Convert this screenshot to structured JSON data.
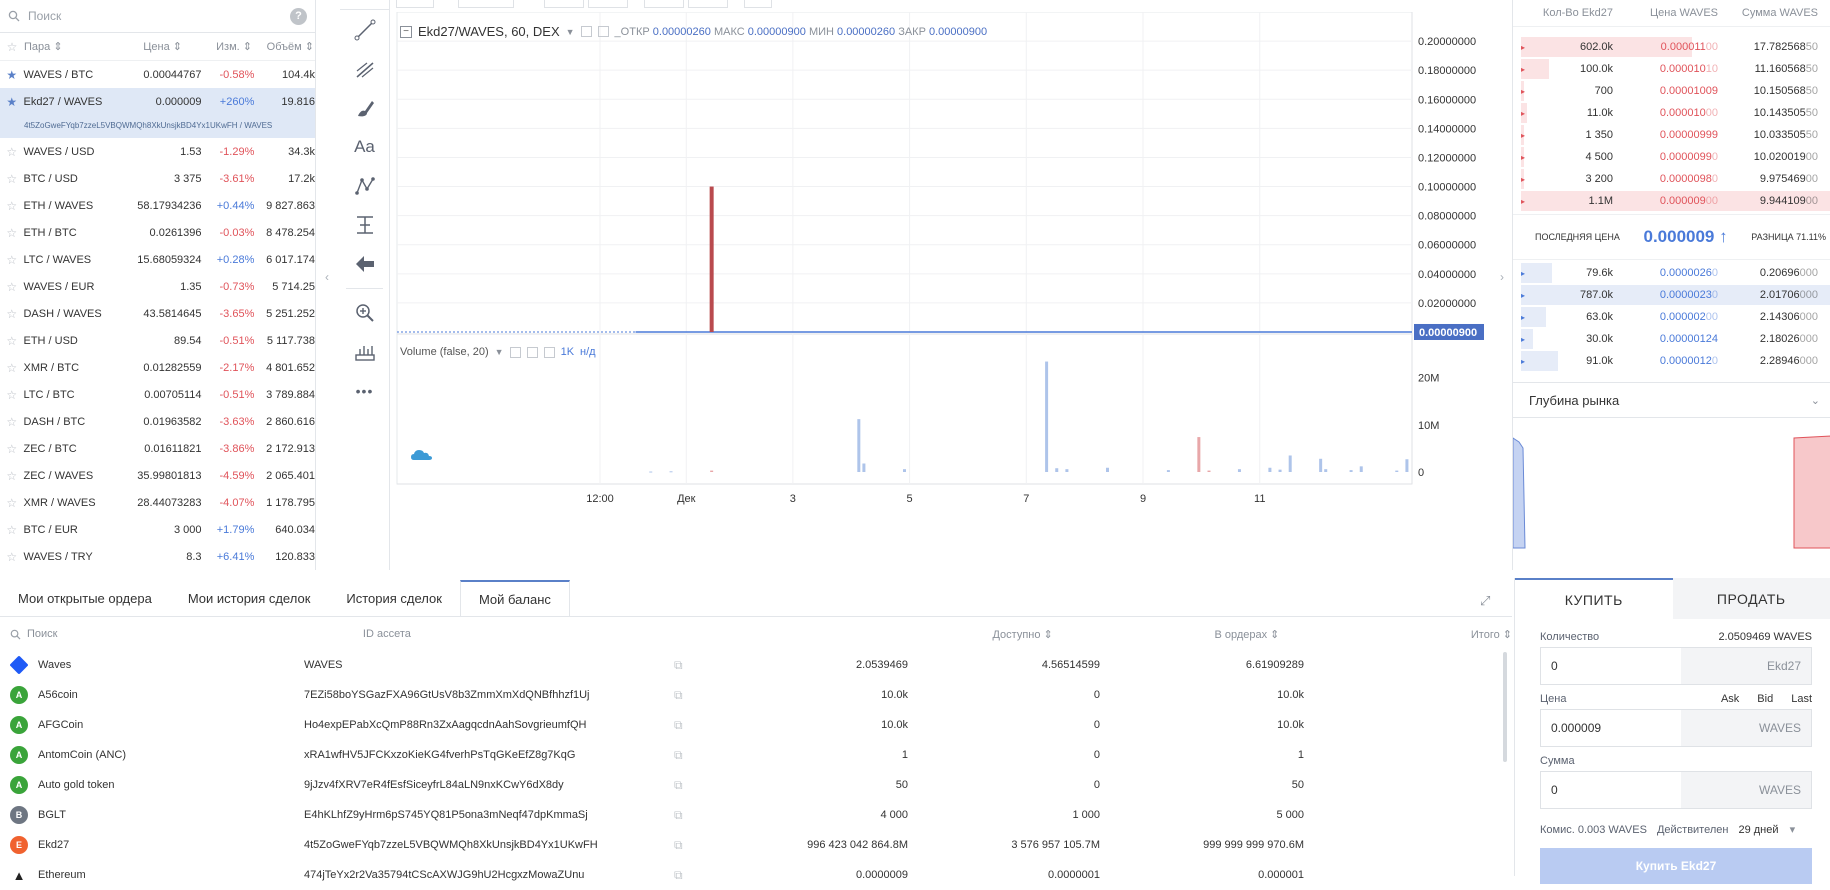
{
  "pairs": {
    "search_placeholder": "Поиск",
    "headers": {
      "pair": "Пара",
      "price": "Цена",
      "change": "Изм.",
      "volume": "Объём"
    },
    "rows": [
      {
        "pair": "WAVES / BTC",
        "price": "0.00044767",
        "change": "-0.58%",
        "volume": "104.4k",
        "fav": true,
        "dir": "neg"
      },
      {
        "pair": "Ekd27 / WAVES",
        "price": "0.000009",
        "change": "+260%",
        "volume": "19.816",
        "fav": true,
        "dir": "pos",
        "selected": true,
        "address": "4t5ZoGweFYqb7zzeL5VBQWMQh8XkUnsjkBD4Yx1UKwFH / WAVES"
      },
      {
        "pair": "WAVES / USD",
        "price": "1.53",
        "change": "-1.29%",
        "volume": "34.3k",
        "dir": "neg"
      },
      {
        "pair": "BTC / USD",
        "price": "3 375",
        "change": "-3.61%",
        "volume": "17.2k",
        "dir": "neg"
      },
      {
        "pair": "ETH / WAVES",
        "price": "58.17934236",
        "change": "+0.44%",
        "volume": "9 827.863",
        "dir": "pos"
      },
      {
        "pair": "ETH / BTC",
        "price": "0.0261396",
        "change": "-0.03%",
        "volume": "8 478.254",
        "dir": "neg"
      },
      {
        "pair": "LTC / WAVES",
        "price": "15.68059324",
        "change": "+0.28%",
        "volume": "6 017.174",
        "dir": "pos"
      },
      {
        "pair": "WAVES / EUR",
        "price": "1.35",
        "change": "-0.73%",
        "volume": "5 714.25",
        "dir": "neg"
      },
      {
        "pair": "DASH / WAVES",
        "price": "43.5814645",
        "change": "-3.65%",
        "volume": "5 251.252",
        "dir": "neg"
      },
      {
        "pair": "ETH / USD",
        "price": "89.54",
        "change": "-0.51%",
        "volume": "5 117.738",
        "dir": "neg"
      },
      {
        "pair": "XMR / BTC",
        "price": "0.01282559",
        "change": "-2.17%",
        "volume": "4 801.652",
        "dir": "neg"
      },
      {
        "pair": "LTC / BTC",
        "price": "0.00705114",
        "change": "-0.51%",
        "volume": "3 789.884",
        "dir": "neg"
      },
      {
        "pair": "DASH / BTC",
        "price": "0.01963582",
        "change": "-3.63%",
        "volume": "2 860.616",
        "dir": "neg"
      },
      {
        "pair": "ZEC / BTC",
        "price": "0.01611821",
        "change": "-3.86%",
        "volume": "2 172.913",
        "dir": "neg"
      },
      {
        "pair": "ZEC / WAVES",
        "price": "35.99801813",
        "change": "-4.59%",
        "volume": "2 065.401",
        "dir": "neg"
      },
      {
        "pair": "XMR / WAVES",
        "price": "28.44073283",
        "change": "-4.07%",
        "volume": "1 178.795",
        "dir": "neg"
      },
      {
        "pair": "BTC / EUR",
        "price": "3 000",
        "change": "+1.79%",
        "volume": "640.034",
        "dir": "pos"
      },
      {
        "pair": "WAVES / TRY",
        "price": "8.3",
        "change": "+6.41%",
        "volume": "120.833",
        "dir": "pos"
      }
    ]
  },
  "toolbar": {
    "tools": [
      "trend-line-icon",
      "fib-icon",
      "brush-icon",
      "text-icon",
      "pattern-icon",
      "measure-icon",
      "arrow-left-icon",
      "zoom-in-icon",
      "ruler-icon",
      "more-icon"
    ],
    "text_tool": "Aa",
    "more": "•••"
  },
  "chart": {
    "title": "Ekd27/WAVES, 60, DEX",
    "ohlc": {
      "open_label": "ОТКР",
      "open": "0.00000260",
      "high_label": "МАКС",
      "high": "0.00000900",
      "low_label": "МИН",
      "low": "0.00000260",
      "close_label": "ЗАКР",
      "close": "0.00000900"
    },
    "volume_caption": "Volume (false, 20)",
    "interval_1k": "1K",
    "interval_w": "н/д",
    "last_price_tag": "0.00000900",
    "colors": {
      "up": "#4a7ad9",
      "down": "#b94a4e",
      "vol_up": "#aec4ea",
      "vol_down": "#e8a7a9"
    }
  },
  "chart_data": {
    "type": "bar",
    "title": "Ekd27/WAVES, 60, DEX",
    "xlabel": "",
    "ylabel": "",
    "x_ticks": [
      "12:00",
      "Дек",
      "3",
      "5",
      "7",
      "9",
      "11"
    ],
    "price_ticks": [
      "0.20000000",
      "0.18000000",
      "0.16000000",
      "0.14000000",
      "0.12000000",
      "0.10000000",
      "0.08000000",
      "0.06000000",
      "0.04000000",
      "0.02000000"
    ],
    "ylim": [
      0,
      0.22
    ],
    "price_series": {
      "name": "Ekd27/WAVES",
      "line_level": 9e-06,
      "spike": {
        "position": 0.31,
        "value": 0.1
      }
    },
    "volume_ticks": [
      "20M",
      "10M",
      "0"
    ],
    "volume_ylim": [
      0,
      25000000
    ],
    "volume_bars": [
      {
        "t": 0.25,
        "v": 100000,
        "d": "up"
      },
      {
        "t": 0.27,
        "v": 150000,
        "d": "up"
      },
      {
        "t": 0.31,
        "v": 300000,
        "d": "down"
      },
      {
        "t": 0.455,
        "v": 11200000,
        "d": "up"
      },
      {
        "t": 0.46,
        "v": 1800000,
        "d": "up"
      },
      {
        "t": 0.5,
        "v": 600000,
        "d": "up"
      },
      {
        "t": 0.64,
        "v": 23400000,
        "d": "up"
      },
      {
        "t": 0.65,
        "v": 800000,
        "d": "up"
      },
      {
        "t": 0.66,
        "v": 600000,
        "d": "up"
      },
      {
        "t": 0.7,
        "v": 900000,
        "d": "up"
      },
      {
        "t": 0.76,
        "v": 400000,
        "d": "up"
      },
      {
        "t": 0.79,
        "v": 7400000,
        "d": "down"
      },
      {
        "t": 0.8,
        "v": 300000,
        "d": "down"
      },
      {
        "t": 0.83,
        "v": 600000,
        "d": "up"
      },
      {
        "t": 0.86,
        "v": 900000,
        "d": "up"
      },
      {
        "t": 0.87,
        "v": 500000,
        "d": "up"
      },
      {
        "t": 0.88,
        "v": 3500000,
        "d": "up"
      },
      {
        "t": 0.91,
        "v": 2800000,
        "d": "up"
      },
      {
        "t": 0.915,
        "v": 600000,
        "d": "up"
      },
      {
        "t": 0.94,
        "v": 400000,
        "d": "up"
      },
      {
        "t": 0.95,
        "v": 1200000,
        "d": "up"
      },
      {
        "t": 0.985,
        "v": 300000,
        "d": "up"
      },
      {
        "t": 0.995,
        "v": 2700000,
        "d": "up"
      }
    ]
  },
  "book": {
    "headers": {
      "amount": "Кол-Во Ekd27",
      "price": "Цена WAVES",
      "sum": "Сумма WAVES"
    },
    "asks": [
      {
        "amount": "602.0k",
        "price_main": "0.000011",
        "price_tail": "00",
        "sum_main": "17.782568",
        "sum_tail": "50",
        "depth": 0.55
      },
      {
        "amount": "100.0k",
        "price_main": "0.000010",
        "price_tail": "10",
        "sum_main": "11.160568",
        "sum_tail": "50",
        "depth": 0.09
      },
      {
        "amount": "700",
        "price_main": "0.00001009",
        "price_tail": "",
        "sum_main": "10.150568",
        "sum_tail": "50",
        "depth": 0.01
      },
      {
        "amount": "11.0k",
        "price_main": "0.000010",
        "price_tail": "00",
        "sum_main": "10.143505",
        "sum_tail": "50",
        "depth": 0.02
      },
      {
        "amount": "1 350",
        "price_main": "0.00000999",
        "price_tail": "",
        "sum_main": "10.033505",
        "sum_tail": "50",
        "depth": 0.01
      },
      {
        "amount": "4 500",
        "price_main": "0.0000099",
        "price_tail": "0",
        "sum_main": "10.020019",
        "sum_tail": "00",
        "depth": 0.01
      },
      {
        "amount": "3 200",
        "price_main": "0.0000098",
        "price_tail": "0",
        "sum_main": "9.975469",
        "sum_tail": "00",
        "depth": 0.01
      },
      {
        "amount": "1.1M",
        "price_main": "0.000009",
        "price_tail": "00",
        "sum_main": "9.944109",
        "sum_tail": "00",
        "depth": 1.0
      }
    ],
    "last_price_label": "ПОСЛЕДНЯЯ ЦЕНА",
    "last_price": "0.000009 ↑",
    "spread_label": "РАЗНИЦА 71.11%",
    "bids": [
      {
        "amount": "79.6k",
        "price_main": "0.0000026",
        "price_tail": "0",
        "sum_main": "0.20696",
        "sum_tail": "000",
        "depth": 0.1
      },
      {
        "amount": "787.0k",
        "price_main": "0.0000023",
        "price_tail": "0",
        "sum_main": "2.01706",
        "sum_tail": "000",
        "depth": 1.0
      },
      {
        "amount": "63.0k",
        "price_main": "0.000002",
        "price_tail": "00",
        "sum_main": "2.14306",
        "sum_tail": "000",
        "depth": 0.08
      },
      {
        "amount": "30.0k",
        "price_main": "0.00000124",
        "price_tail": "",
        "sum_main": "2.18026",
        "sum_tail": "000",
        "depth": 0.04
      },
      {
        "amount": "91.0k",
        "price_main": "0.0000012",
        "price_tail": "0",
        "sum_main": "2.28946",
        "sum_tail": "000",
        "depth": 0.12
      }
    ],
    "depth_title": "Глубина рынка"
  },
  "bottom_tabs": [
    "Мои открытые ордера",
    "Мои история сделок",
    "История сделок",
    "Мой баланс"
  ],
  "balance": {
    "search_placeholder": "Поиск",
    "headers": {
      "id": "ID ассета",
      "available": "Доступно",
      "in_orders": "В ордерах",
      "total": "Итого"
    },
    "rows": [
      {
        "name": "Waves",
        "icon": "W",
        "color": "#1f5af6",
        "diamond": true,
        "id": "WAVES",
        "available": "2.0539469",
        "in_orders": "4.56514599",
        "total": "6.61909289"
      },
      {
        "name": "A56coin",
        "icon": "A",
        "color": "#3aa43a",
        "id": "7EZi58boYSGazFXA96GtUsV8b3ZmmXmXdQNBfhhzf1Uj",
        "available": "10.0k",
        "in_orders": "0",
        "total": "10.0k"
      },
      {
        "name": "AFGCoin",
        "icon": "A",
        "color": "#3aa43a",
        "id": "Ho4expEPabXcQmP88Rn3ZxAagqcdnAahSovgrieumfQH",
        "available": "10.0k",
        "in_orders": "0",
        "total": "10.0k"
      },
      {
        "name": "AntomCoin (ANC)",
        "icon": "A",
        "color": "#3aa43a",
        "id": "xRA1wfHV5JFCKxzoKieKG4fverhPsTqGKeEfZ8g7KqG",
        "available": "1",
        "in_orders": "0",
        "total": "1"
      },
      {
        "name": "Auto gold token",
        "icon": "A",
        "color": "#3aa43a",
        "id": "9jJzv4fXRV7eR4fEsfSiceyfrL84aLN9nxKCwY6dX8dy",
        "available": "50",
        "in_orders": "0",
        "total": "50"
      },
      {
        "name": "BGLT",
        "icon": "B",
        "color": "#6e7682",
        "id": "E4hKLhfZ9yHrm6pS745YQ81P5ona3mNeqf47dpKmmaSj",
        "available": "4 000",
        "in_orders": "1 000",
        "total": "5 000"
      },
      {
        "name": "Ekd27",
        "icon": "E",
        "color": "#f0622f",
        "id": "4t5ZoGweFYqb7zzeL5VBQWMQh8XkUnsjkBD4Yx1UKwFH",
        "available": "996 423 042 864.8M",
        "in_orders": "3 576 957 105.7M",
        "total": "999 999 999 970.6M"
      },
      {
        "name": "Ethereum",
        "icon": "◆",
        "color": "#222",
        "triangle": true,
        "id": "474jTeYx2r2Va35794tCScAXWJG9hU2HcgxzMowaZUnu",
        "available": "0.0000009",
        "in_orders": "0.0000001",
        "total": "0.000001"
      }
    ]
  },
  "trade": {
    "buy_tab": "КУПИТЬ",
    "sell_tab": "ПРОДАТЬ",
    "amount_label": "Количество",
    "amount_max": "2.0509469 WAVES",
    "amount_value": "0",
    "amount_unit": "Ekd27",
    "price_label": "Цена",
    "ask": "Ask",
    "bid": "Bid",
    "last": "Last",
    "price_value": "0.000009",
    "price_unit": "WAVES",
    "sum_label": "Сумма",
    "sum_value": "0",
    "sum_unit": "WAVES",
    "fee": "Комис. 0.003 WAVES",
    "valid_label": "Действителен",
    "valid_value": "29 дней",
    "submit": "Купить Ekd27"
  }
}
